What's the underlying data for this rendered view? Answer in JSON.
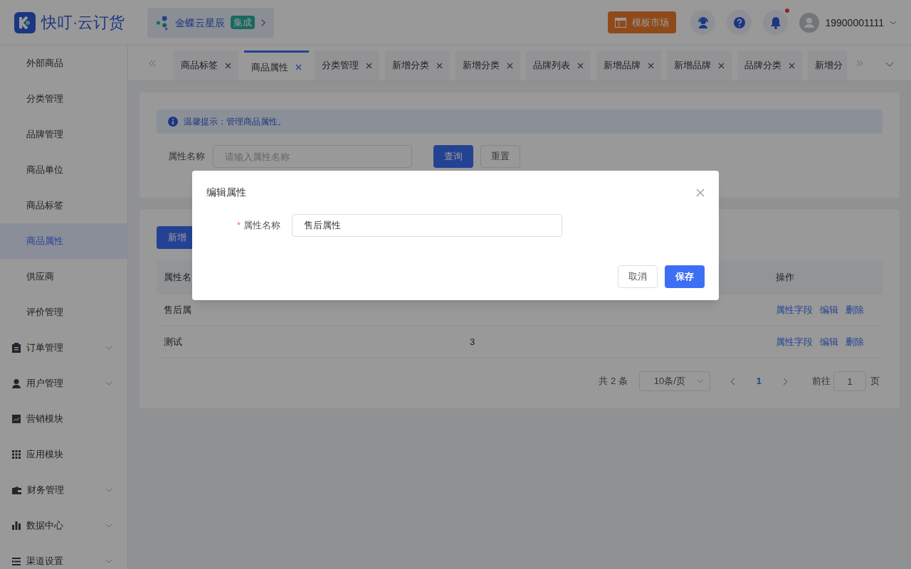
{
  "header": {
    "logo_text": "快叮·云订货",
    "integration": {
      "name": "金蝶云星辰",
      "badge": "集成"
    },
    "template_button": "模板市场",
    "user": "19900001111"
  },
  "sidebar": {
    "items": [
      {
        "label": "外部商品",
        "kind": "sub",
        "selected": false
      },
      {
        "label": "分类管理",
        "kind": "sub",
        "selected": false
      },
      {
        "label": "品牌管理",
        "kind": "sub",
        "selected": false
      },
      {
        "label": "商品单位",
        "kind": "sub",
        "selected": false
      },
      {
        "label": "商品标签",
        "kind": "sub",
        "selected": false
      },
      {
        "label": "商品属性",
        "kind": "sub",
        "selected": true
      },
      {
        "label": "供应商",
        "kind": "sub",
        "selected": false
      },
      {
        "label": "评价管理",
        "kind": "sub",
        "selected": false
      },
      {
        "label": "订单管理",
        "kind": "group",
        "selected": false,
        "expandable": true
      },
      {
        "label": "用户管理",
        "kind": "group",
        "selected": false,
        "expandable": true
      },
      {
        "label": "营销模块",
        "kind": "group",
        "selected": false,
        "expandable": false
      },
      {
        "label": "应用模块",
        "kind": "group",
        "selected": false,
        "expandable": false
      },
      {
        "label": "财务管理",
        "kind": "group",
        "selected": false,
        "expandable": true
      },
      {
        "label": "数据中心",
        "kind": "group",
        "selected": false,
        "expandable": true
      },
      {
        "label": "渠道设置",
        "kind": "group",
        "selected": false,
        "expandable": true
      }
    ]
  },
  "tabs": [
    {
      "label": "商品标签",
      "selected": false
    },
    {
      "label": "商品属性",
      "selected": true
    },
    {
      "label": "分类管理",
      "selected": false
    },
    {
      "label": "新增分类",
      "selected": false
    },
    {
      "label": "新增分类",
      "selected": false
    },
    {
      "label": "品牌列表",
      "selected": false
    },
    {
      "label": "新增品牌",
      "selected": false
    },
    {
      "label": "新增品牌",
      "selected": false
    },
    {
      "label": "品牌分类",
      "selected": false
    },
    {
      "label": "新增分",
      "selected": false
    }
  ],
  "notice": "温馨提示：管理商品属性。",
  "search": {
    "label": "属性名称",
    "placeholder": "请输入属性名称",
    "buttons": [
      "查询",
      "重置"
    ]
  },
  "add_button": "新增",
  "table": {
    "columns": [
      "属性名",
      "操作"
    ],
    "rows": [
      {
        "name": "售后属",
        "actions": [
          "属性字段",
          "编辑",
          "删除"
        ]
      },
      {
        "name": "测试",
        "count": "3",
        "actions": [
          "属性字段",
          "编辑",
          "删除"
        ]
      }
    ]
  },
  "pagination": {
    "total": "共 2 条",
    "page_size": "10条/页",
    "current": "1",
    "goto_label": "前往",
    "goto_value": "1",
    "page_suffix": "页"
  },
  "modal": {
    "title": "编辑属性",
    "field_label": "属性名称",
    "required_mark": "*",
    "field_value": "售后属性",
    "buttons": [
      "取消",
      "保存"
    ]
  }
}
